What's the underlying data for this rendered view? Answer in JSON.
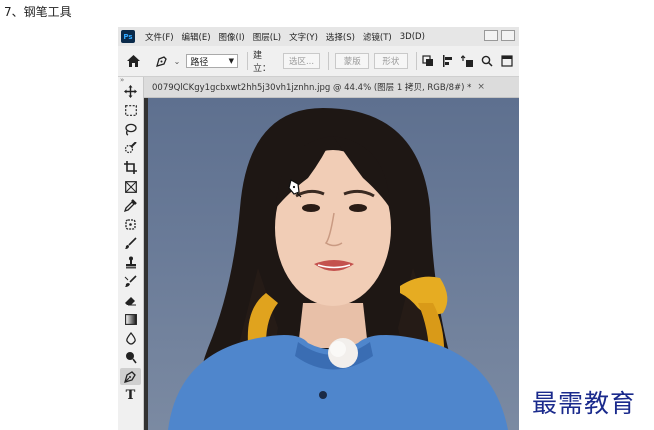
{
  "caption": "7、钢笔工具",
  "app": {
    "logo": "Ps",
    "menu": [
      "文件(F)",
      "编辑(E)",
      "图像(I)",
      "图层(L)",
      "文字(Y)",
      "选择(S)",
      "滤镜(T)",
      "3D(D)"
    ]
  },
  "options_bar": {
    "mode_value": "路径",
    "build_label": "建立：",
    "buttons": [
      "选区...",
      "蒙版",
      "形状"
    ]
  },
  "document_tab": {
    "label": "0079QlCKgy1gcbxwt2hh5j30vh1jznhn.jpg @ 44.4% (图层 1 拷贝, RGB/8#) *",
    "close": "×"
  },
  "toolbar": {
    "collapse": "»",
    "tools": [
      {
        "name": "move-tool",
        "icon": "move-icon"
      },
      {
        "name": "marquee-tool",
        "icon": "rect-marquee-icon"
      },
      {
        "name": "lasso-tool",
        "icon": "lasso-icon"
      },
      {
        "name": "quick-select-tool",
        "icon": "quick-select-icon"
      },
      {
        "name": "crop-tool",
        "icon": "crop-icon"
      },
      {
        "name": "frame-tool",
        "icon": "frame-icon"
      },
      {
        "name": "eyedropper-tool",
        "icon": "eyedropper-icon"
      },
      {
        "name": "healing-tool",
        "icon": "healing-icon"
      },
      {
        "name": "brush-tool",
        "icon": "brush-icon"
      },
      {
        "name": "stamp-tool",
        "icon": "stamp-icon"
      },
      {
        "name": "history-brush-tool",
        "icon": "history-brush-icon"
      },
      {
        "name": "eraser-tool",
        "icon": "eraser-icon"
      },
      {
        "name": "gradient-tool",
        "icon": "gradient-icon"
      },
      {
        "name": "blur-tool",
        "icon": "blur-icon"
      },
      {
        "name": "dodge-tool",
        "icon": "dodge-icon"
      },
      {
        "name": "pen-tool",
        "icon": "pen-icon",
        "active": true
      },
      {
        "name": "type-tool",
        "icon": "type-icon",
        "text": "T"
      }
    ]
  },
  "watermark": "最需教育"
}
